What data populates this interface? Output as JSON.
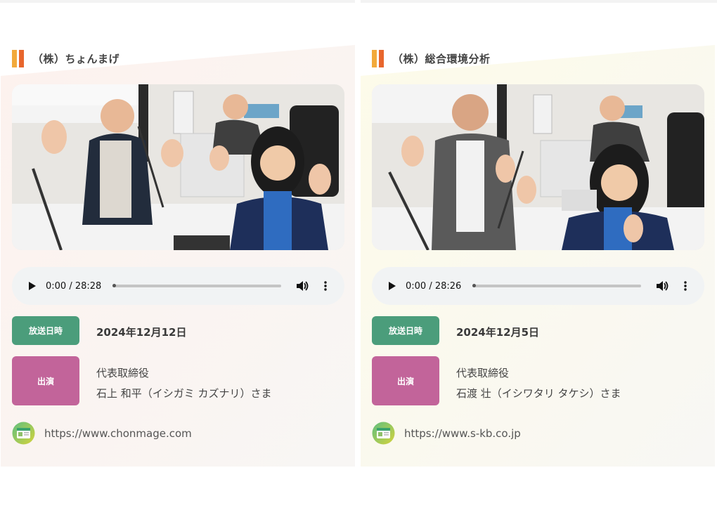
{
  "colors": {
    "title_mark_left": "#f0a030",
    "title_mark_right": "#e6572a",
    "date_badge": "#4b9d7b",
    "cast_badge": "#c2649a",
    "player_bg": "#f1f3f4"
  },
  "cards": [
    {
      "title": "（株）ちょんまげ",
      "photo_icon": "photo-radio-studio",
      "audio": {
        "time": "0:00 / 28:28",
        "progress": 0
      },
      "date_badge": "放送日時",
      "date": "2024年12月12日",
      "cast_badge": "出演",
      "cast_role": "代表取締役",
      "cast_name": "石上 和平（イシガミ カズナリ）さま",
      "url": "https://www.chonmage.com"
    },
    {
      "title": "（株）総合環境分析",
      "photo_icon": "photo-radio-studio",
      "audio": {
        "time": "0:00 / 28:26",
        "progress": 0
      },
      "date_badge": "放送日時",
      "date": "2024年12月5日",
      "cast_badge": "出演",
      "cast_role": "代表取締役",
      "cast_name": "石渡 壮（イシワタリ タケシ）さま",
      "url": "https://www.s-kb.co.jp"
    }
  ]
}
